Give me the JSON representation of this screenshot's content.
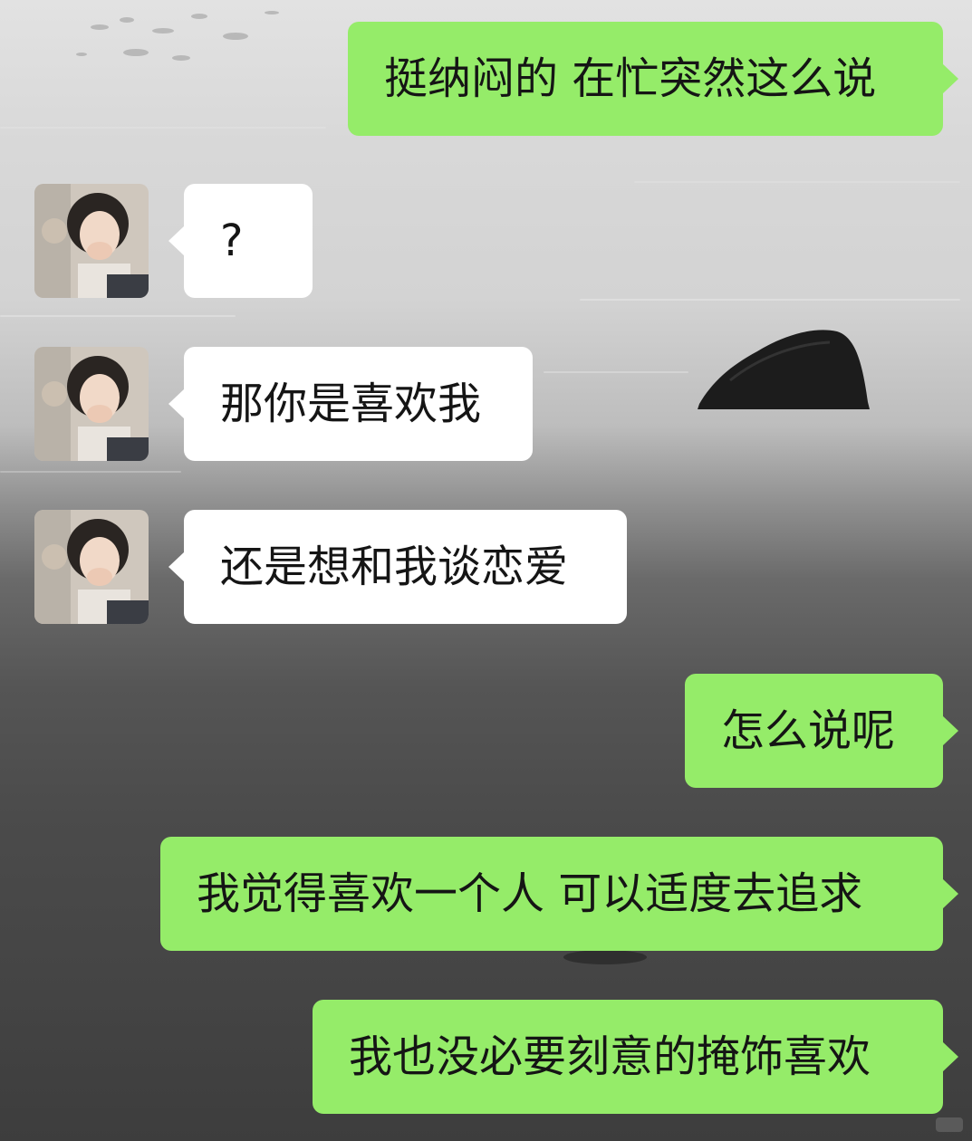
{
  "conversation": {
    "messages": [
      {
        "sender": "self",
        "text": "挺纳闷的 在忙突然这么说"
      },
      {
        "sender": "contact",
        "text": "?"
      },
      {
        "sender": "contact",
        "text": "那你是喜欢我"
      },
      {
        "sender": "contact",
        "text": "还是想和我谈恋爱"
      },
      {
        "sender": "self",
        "text": "怎么说呢"
      },
      {
        "sender": "self",
        "text": "我觉得喜欢一个人 可以适度去追求"
      },
      {
        "sender": "self",
        "text": "我也没必要刻意的掩饰喜欢"
      }
    ]
  },
  "contact": {
    "avatar_icon": "profile-photo-girl-covering-mouth"
  },
  "background": {
    "scene": "beach-sand-with-rock"
  },
  "colors": {
    "outgoing_bubble": "#95ec69",
    "incoming_bubble": "#ffffff",
    "text": "#151515"
  }
}
